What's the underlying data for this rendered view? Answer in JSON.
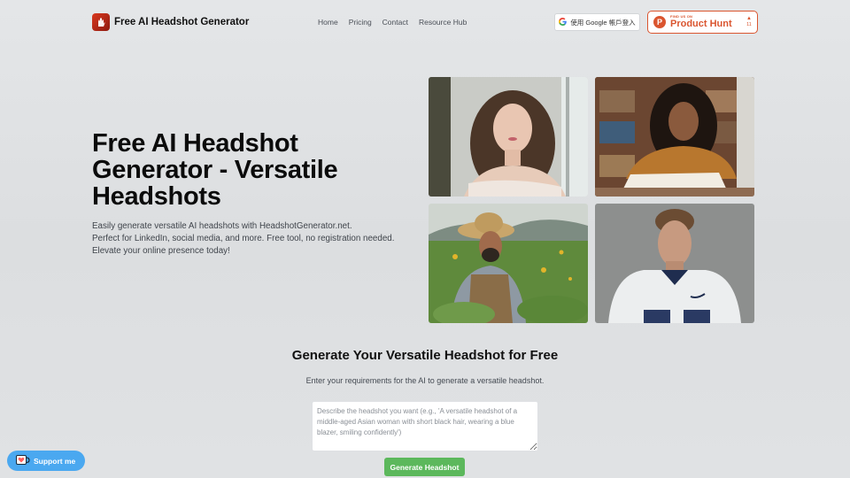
{
  "header": {
    "brand_name": "Free AI Headshot Generator",
    "nav": [
      {
        "label": "Home"
      },
      {
        "label": "Pricing"
      },
      {
        "label": "Contact"
      },
      {
        "label": "Resource Hub"
      }
    ],
    "google_login_label": "使用 Google 帳戶登入",
    "product_hunt": {
      "small_label": "FIND US ON",
      "big_label": "Product Hunt",
      "votes": "11",
      "accent_color": "#da552f"
    }
  },
  "hero": {
    "title": "Free AI Headshot Generator - Versatile Headshots",
    "description_lines": [
      "Easily generate versatile AI headshots with HeadshotGenerator.net.",
      "Perfect for LinkedIn, social media, and more. Free tool, no registration needed.",
      "Elevate your online presence today!"
    ],
    "gallery": [
      {
        "alt": "Young Asian woman with long wavy hair by a window"
      },
      {
        "alt": "Smiling woman with curly hair reading a book in a library"
      },
      {
        "alt": "Smiling farmer in straw hat in a green field"
      },
      {
        "alt": "Football player in white jersey against gray backdrop"
      }
    ]
  },
  "generator": {
    "title": "Generate Your Versatile Headshot for Free",
    "subtitle": "Enter your requirements for the AI to generate a versatile headshot.",
    "prompt_value": "",
    "prompt_placeholder": "Describe the headshot you want (e.g., 'A versatile headshot of a middle-aged Asian woman with short black hair, wearing a blue blazer, smiling confidently')",
    "button_label": "Generate Headshot",
    "button_color": "#5cb85c"
  },
  "support_widget": {
    "label": "Support me",
    "color": "#4aa8f0"
  }
}
